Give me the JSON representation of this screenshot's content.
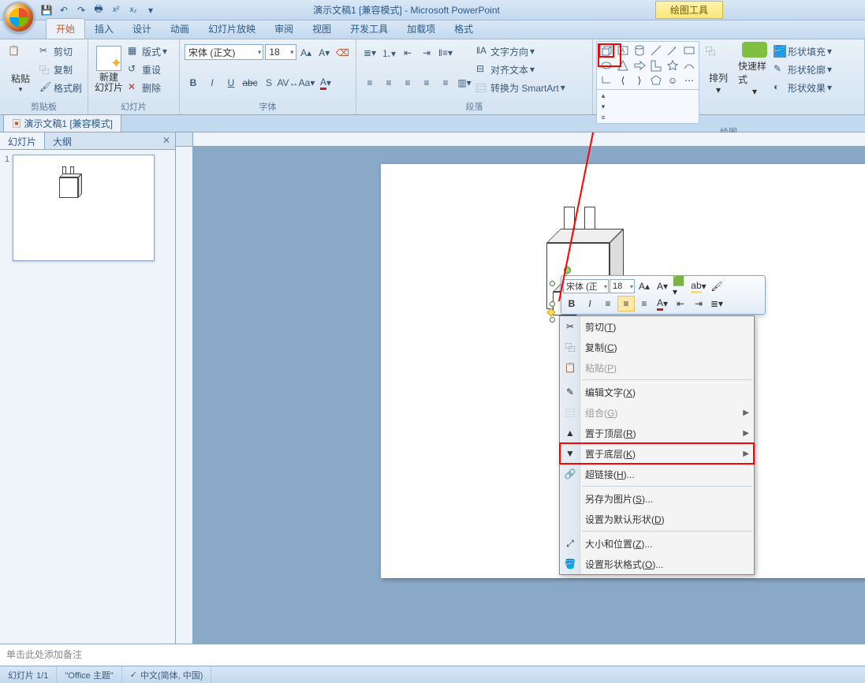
{
  "title": {
    "doc": "演示文稿1 [兼容模式]",
    "app": "Microsoft PowerPoint",
    "toolTab": "绘图工具"
  },
  "qat": [
    "save",
    "undo",
    "redo",
    "print",
    "sup",
    "sub",
    "dd"
  ],
  "tabs": [
    "开始",
    "插入",
    "设计",
    "动画",
    "幻灯片放映",
    "审阅",
    "视图",
    "开发工具",
    "加载项",
    "格式"
  ],
  "activeTab": 0,
  "ribbon": {
    "clipboard": {
      "label": "剪贴板",
      "paste": "粘贴",
      "cut": "剪切",
      "copy": "复制",
      "formatPainter": "格式刷"
    },
    "slides": {
      "label": "幻灯片",
      "newSlide": "新建\n幻灯片",
      "layout": "版式",
      "reset": "重设",
      "delete": "删除"
    },
    "font": {
      "label": "字体",
      "name": "宋体 (正文)",
      "size": "18"
    },
    "paragraph": {
      "label": "段落",
      "textDir": "文字方向",
      "align": "对齐文本",
      "smartart": "转换为 SmartArt"
    },
    "drawing": {
      "label": "绘图",
      "arrange": "排列",
      "quickStyles": "快速样式",
      "fill": "形状填充",
      "outline": "形状轮廓",
      "effects": "形状效果"
    }
  },
  "docTab": "演示文稿1 [兼容模式]",
  "sidePanel": {
    "tabs": [
      "幻灯片",
      "大纲"
    ],
    "active": 0
  },
  "notesPlaceholder": "单击此处添加备注",
  "statusbar": {
    "slide": "幻灯片 1/1",
    "theme": "\"Office 主题\"",
    "lang": "中文(简体, 中国)"
  },
  "miniToolbar": {
    "font": "宋体 (正",
    "size": "18"
  },
  "contextMenu": [
    {
      "type": "item",
      "label_pre": "剪切(",
      "accel": "T",
      "label_post": ")",
      "icon": "cut"
    },
    {
      "type": "item",
      "label_pre": "复制(",
      "accel": "C",
      "label_post": ")",
      "icon": "copy"
    },
    {
      "type": "item",
      "label_pre": "粘贴(",
      "accel": "P",
      "label_post": ")",
      "icon": "paste",
      "disabled": true
    },
    {
      "type": "sep"
    },
    {
      "type": "item",
      "label_pre": "编辑文字(",
      "accel": "X",
      "label_post": ")",
      "icon": "edit"
    },
    {
      "type": "item",
      "label_pre": "组合(",
      "accel": "G",
      "label_post": ")",
      "icon": "group",
      "disabled": true,
      "sub": true
    },
    {
      "type": "item",
      "label_pre": "置于顶层(",
      "accel": "R",
      "label_post": ")",
      "icon": "front",
      "sub": true
    },
    {
      "type": "item",
      "label_pre": "置于底层(",
      "accel": "K",
      "label_post": ")",
      "icon": "back",
      "sub": true,
      "highlight": true
    },
    {
      "type": "item",
      "label_pre": "超链接(",
      "accel": "H",
      "label_post": ")...",
      "icon": "link"
    },
    {
      "type": "sep"
    },
    {
      "type": "item",
      "label_pre": "另存为图片(",
      "accel": "S",
      "label_post": ")..."
    },
    {
      "type": "item",
      "label_pre": "设置为默认形状(",
      "accel": "D",
      "label_post": ")"
    },
    {
      "type": "sep"
    },
    {
      "type": "item",
      "label_pre": "大小和位置(",
      "accel": "Z",
      "label_post": ")...",
      "icon": "size"
    },
    {
      "type": "item",
      "label_pre": "设置形状格式(",
      "accel": "O",
      "label_post": ")...",
      "icon": "format"
    }
  ]
}
